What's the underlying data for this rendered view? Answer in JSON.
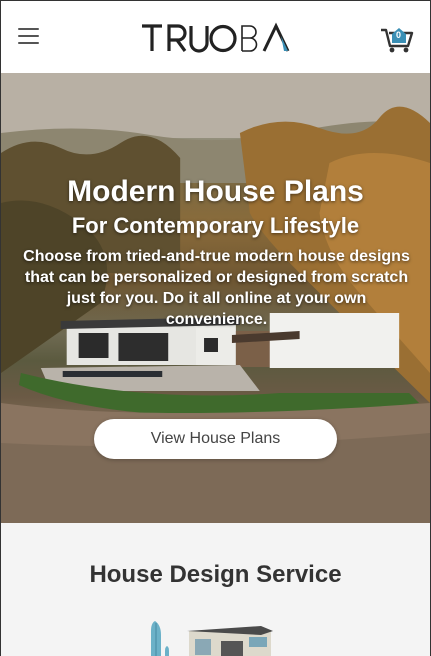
{
  "header": {
    "menu_icon": "hamburger-menu-icon",
    "logo_text": "TRUOBA",
    "cart_icon": "shopping-cart-icon",
    "cart_count": "0",
    "colors": {
      "background": "#ffffff",
      "logo": "#2a2a2a",
      "accent": "#3a8fb5"
    }
  },
  "hero": {
    "title": "Modern House Plans",
    "subtitle": "For Contemporary Lifestyle",
    "description": "Choose from tried-and-true modern house designs that can be personalized or designed from scratch just for you. Do it all online at your own convenience.",
    "cta_label": "View House Plans"
  },
  "service": {
    "title": "House Design Service",
    "illustration": "house-illustration"
  }
}
